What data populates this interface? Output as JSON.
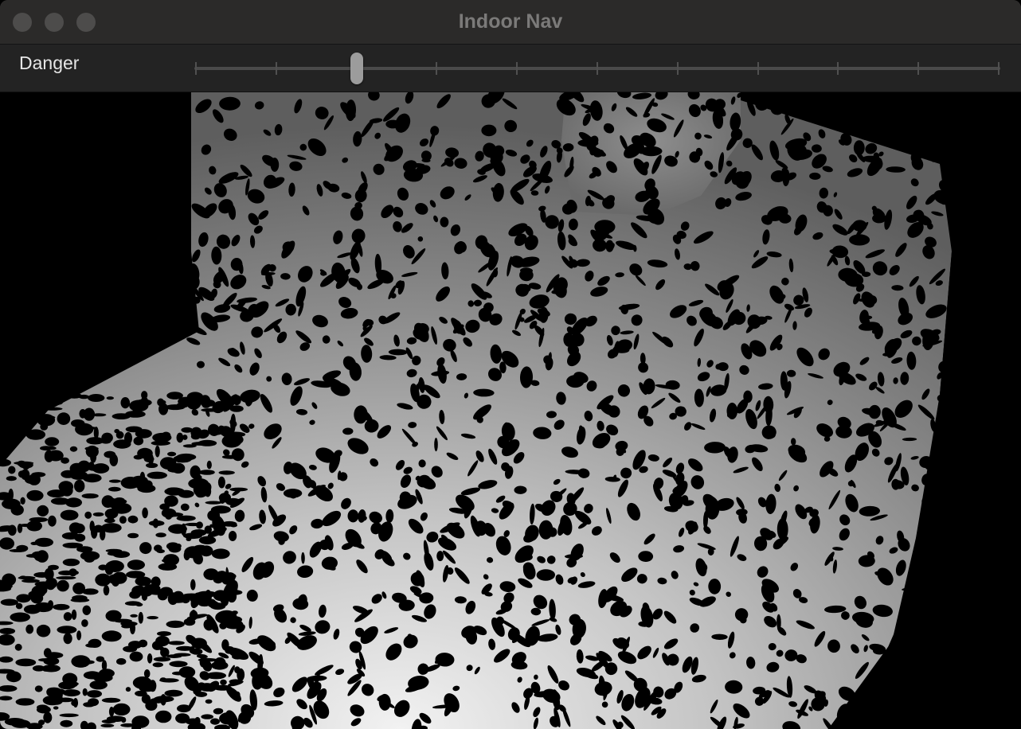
{
  "window": {
    "title": "Indoor Nav"
  },
  "controls": {
    "danger_label": "Danger",
    "danger_slider": {
      "value": 2,
      "min": 0,
      "max": 10,
      "tick_count": 11
    }
  },
  "depth_view": {
    "description_colors": {
      "background": "#000000",
      "near": "#f0f0f0",
      "far": "#5a5a5a"
    }
  },
  "colors": {
    "titlebar": "#2b2a29",
    "toolbar": "#232323",
    "traffic_light_inactive": "#4d4c4b",
    "title_text": "#7b7a79",
    "slider_thumb": "#9c9c9c"
  }
}
